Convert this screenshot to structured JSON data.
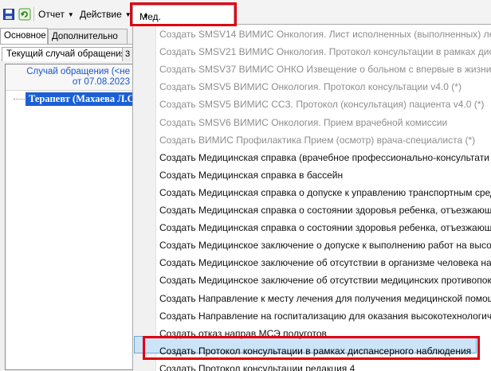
{
  "toolbar": {
    "save_icon": "save-icon",
    "refresh_icon": "refresh-icon"
  },
  "menu": {
    "report": "Отчет",
    "action": "Действие",
    "med_docs": "Мед. документация"
  },
  "left": {
    "tabs": [
      "Основное",
      "Дополнительно"
    ],
    "subtab": "Текущий случай обращения",
    "subtab_next": "3",
    "grid_header_line1": "Случай обращения (<не",
    "grid_header_line2": "от 07.08.2023",
    "tree_node": "Терапевт (Махаева Л.С."
  },
  "dropdown_items": [
    {
      "label": "Создать SMSV14 ВИМИС  Онкология. Лист исполненных (выполненных) ле",
      "enabled": false
    },
    {
      "label": "Создать SMSV21 ВИМИС Онкология. Протокол консультации в рамках дисп",
      "enabled": false
    },
    {
      "label": "Создать SMSV37 ВИМИС ОНКО Извещение о больном с впервые в жизни у",
      "enabled": false
    },
    {
      "label": "Создать SMSV5 ВИМИС Онкология. Протокол консультации v4.0 (*)",
      "enabled": false
    },
    {
      "label": "Создать SMSV5 ВИМИС ССЗ. Протокол (консультация) пациента v4.0 (*)",
      "enabled": false
    },
    {
      "label": "Создать SMSV6 ВИМИС Онкология. Прием врачебной комиссии",
      "enabled": false
    },
    {
      "label": "Создать ВИМИС Профилактика Прием (осмотр) врача-специалиста (*)",
      "enabled": false
    },
    {
      "label": "Создать Медицинская справка (врачебное профессионально-консультати",
      "enabled": true
    },
    {
      "label": "Создать Медицинская справка в бассейн",
      "enabled": true
    },
    {
      "label": "Создать Медицинская справка о допуске к управлению транспортным сред",
      "enabled": true
    },
    {
      "label": "Создать Медицинская справка о состоянии здоровья ребенка, отъезжающе",
      "enabled": true
    },
    {
      "label": "Создать Медицинская справка о состоянии здоровья ребенка, отъезжающе",
      "enabled": true
    },
    {
      "label": "Создать Медицинское заключение о допуске к выполнению работ на высо",
      "enabled": true
    },
    {
      "label": "Создать Медицинское заключение об отсутствии в организме человека нар",
      "enabled": true
    },
    {
      "label": "Создать Медицинское заключение об отсутствии медицинских противопок",
      "enabled": true
    },
    {
      "label": "Создать Направление к месту лечения для получения медицинской помощ",
      "enabled": true
    },
    {
      "label": "Создать Направление на госпитализацию для оказания высокотехнологич",
      "enabled": true
    },
    {
      "label": "Создать отказ направ МСЭ  полуготов",
      "enabled": true
    },
    {
      "label": "Создать Протокол консультации в рамках диспансерного наблюдения",
      "enabled": true,
      "highlighted": true
    },
    {
      "label": "Создать Протокол консультации редакция 4",
      "enabled": true
    }
  ],
  "colors": {
    "highlight_bg": "#cce4f7",
    "selection_blue": "#1b5fd6",
    "annotation_red": "#e0000f"
  }
}
